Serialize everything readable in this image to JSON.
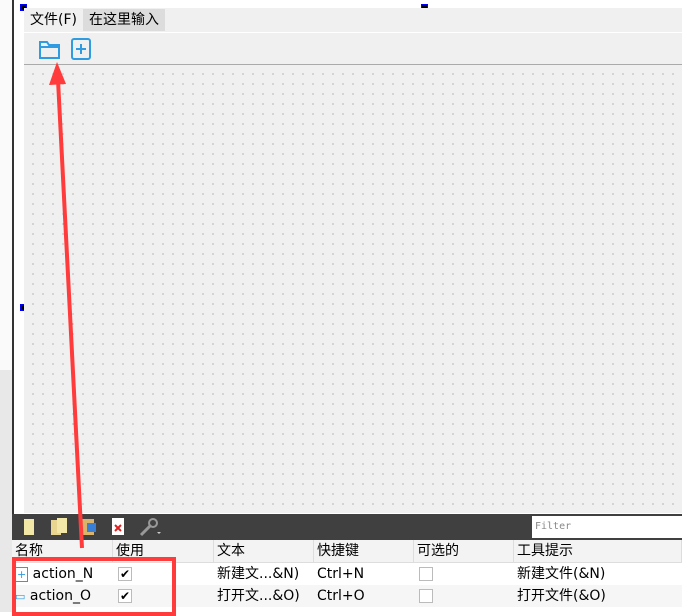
{
  "menubar": {
    "items": [
      {
        "label": "文件(F)"
      },
      {
        "label": "在这里输入"
      }
    ]
  },
  "toolbar": {
    "icons": [
      "folder-open-icon",
      "new-file-icon"
    ]
  },
  "action_editor": {
    "toolbar_icons": [
      "new-action-icon",
      "copy-icon",
      "paste-icon",
      "delete-icon",
      "configure-icon"
    ],
    "filter_placeholder": "Filter",
    "columns": [
      "名称",
      "使用",
      "文本",
      "快捷键",
      "可选的",
      "工具提示"
    ],
    "rows": [
      {
        "name": "action_N",
        "used": true,
        "text": "新建文...&N)",
        "shortcut": "Ctrl+N",
        "checkable": false,
        "tooltip": "新建文件(&N)"
      },
      {
        "name": "action_O",
        "used": true,
        "text": "打开文...&O)",
        "shortcut": "Ctrl+O",
        "checkable": false,
        "tooltip": "打开文件(&O)"
      }
    ]
  },
  "colors": {
    "annotation": "#ff3b3b",
    "icon_blue": "#2f9be0"
  }
}
